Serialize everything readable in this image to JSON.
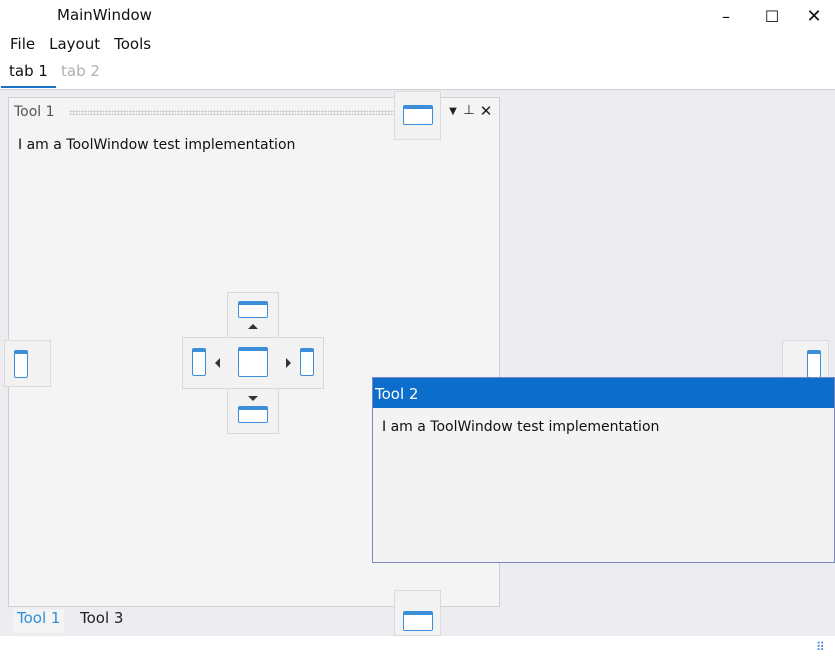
{
  "window": {
    "title": "MainWindow",
    "min_glyph": "–",
    "max_glyph": "☐",
    "close_glyph": "✕"
  },
  "menu": [
    "File",
    "Layout",
    "Tools"
  ],
  "doc_tabs": [
    {
      "label": "tab 1",
      "active": true
    },
    {
      "label": "tab 2",
      "active": false
    }
  ],
  "tool1": {
    "title": "Tool 1",
    "content": "I am a ToolWindow test implementation",
    "dropdown_glyph": "▼",
    "pin_glyph": "⊥",
    "close_glyph": "✕"
  },
  "bottom_tabs": [
    {
      "label": "Tool 1",
      "active": true
    },
    {
      "label": "Tool 3",
      "active": false
    }
  ],
  "tool2": {
    "title": "Tool 2",
    "content": "I am a ToolWindow test implementation"
  },
  "colors": {
    "accent": "#0c6dca",
    "dock_icon": "#3d8ed8",
    "active_bottom_tab": "#2f8fd8",
    "dock_area_bg": "#ececf1"
  },
  "icons": {
    "dock_targets": [
      "dock-top-icon",
      "dock-bottom-icon",
      "dock-left-icon",
      "dock-right-icon",
      "dock-center-icon"
    ],
    "resize_grip": "⠿"
  }
}
